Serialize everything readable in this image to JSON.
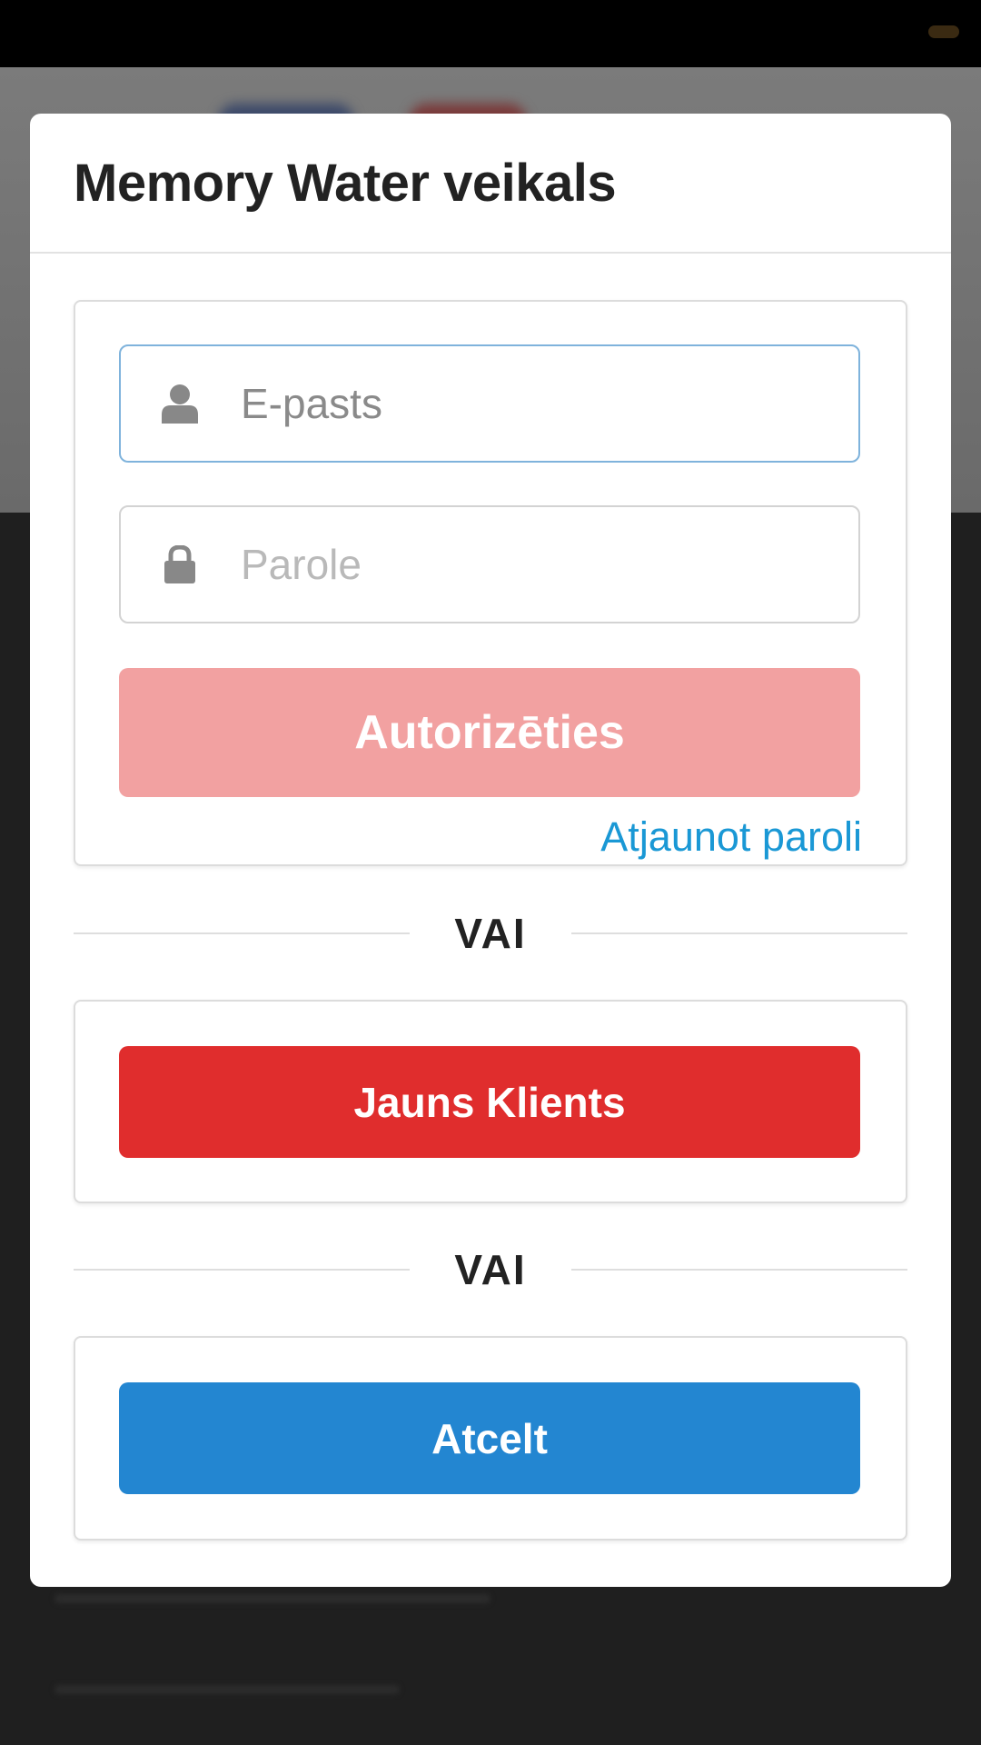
{
  "modal": {
    "title": "Memory Water veikals"
  },
  "login": {
    "email_placeholder": "E-pasts",
    "password_placeholder": "Parole",
    "submit_label": "Autorizēties",
    "reset_link": "Atjaunot paroli"
  },
  "divider_text": "VAI",
  "signup": {
    "label": "Jauns Klients"
  },
  "cancel": {
    "label": "Atcelt"
  },
  "colors": {
    "login_button": "#f2a1a1",
    "signup_button": "#e02d2d",
    "cancel_button": "#2386d1",
    "link": "#1a98d5"
  },
  "icons": {
    "email_field": "user-icon",
    "password_field": "lock-icon"
  }
}
